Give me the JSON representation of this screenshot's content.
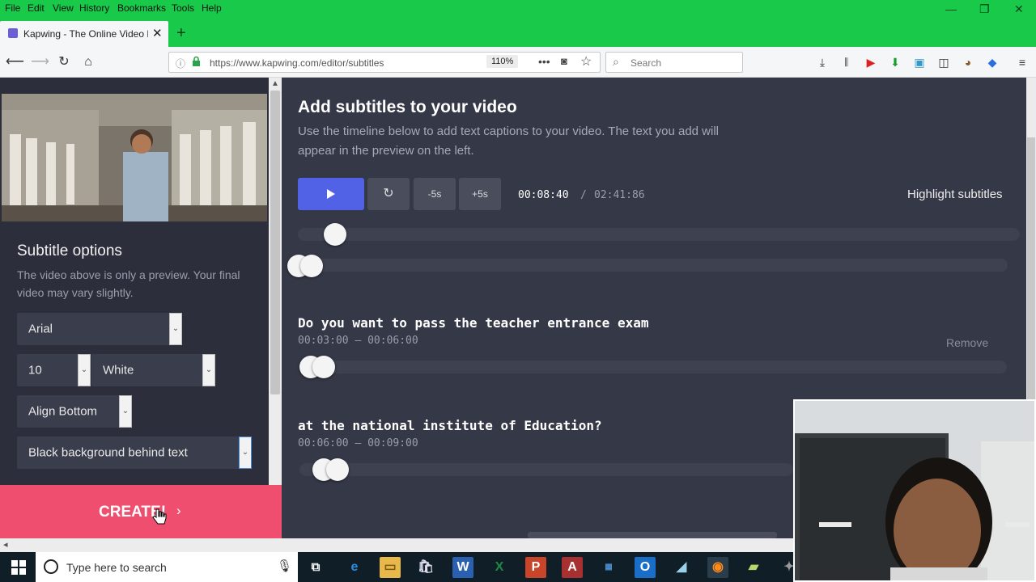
{
  "browser": {
    "menu": [
      "File",
      "Edit",
      "View",
      "History",
      "Bookmarks",
      "Tools",
      "Help"
    ],
    "tab_title": "Kapwing - The Online Video Ed",
    "new_tab": "+",
    "url": "https://www.kapwing.com/editor/subtitles",
    "zoom": "110%",
    "search_placeholder": "Search"
  },
  "sidebar": {
    "heading": "Subtitle options",
    "note": "The video above is only a preview. Your final video may vary slightly.",
    "font": "Arial",
    "size": "10",
    "color": "White",
    "align": "Align Bottom",
    "background": "Black background behind text",
    "create_label": "CREATE!"
  },
  "main": {
    "title": "Add subtitles to your video",
    "description": "Use the timeline below to add text captions to your video. The text you add will appear in the preview on the left.",
    "minus_label": "-5s",
    "plus_label": "+5s",
    "current_time": "00:08:40",
    "separator": "/",
    "total_time": "02:41:86",
    "highlight_label": "Highlight subtitles",
    "playhead_fraction": 0.018,
    "subtitles": [
      {
        "text": "Do you want to pass the teacher entrance exam",
        "range": "00:03:00 – 00:06:00",
        "remove": "Remove"
      },
      {
        "text": "at the national institute of Education?",
        "range": "00:06:00 – 00:09:00"
      }
    ]
  },
  "taskbar": {
    "search_placeholder": "Type here to search"
  },
  "colors": {
    "browser_chrome": "#19c94a",
    "play_button": "#5262e6",
    "create_button": "#f04e6e",
    "panel": "#353847"
  },
  "icons": [
    "back-icon",
    "forward-icon",
    "reload-icon",
    "home-icon",
    "lock-icon",
    "play-icon",
    "replay-icon",
    "cursor-hand-icon",
    "windows-start-icon",
    "cortana-icon",
    "microphone-icon"
  ]
}
